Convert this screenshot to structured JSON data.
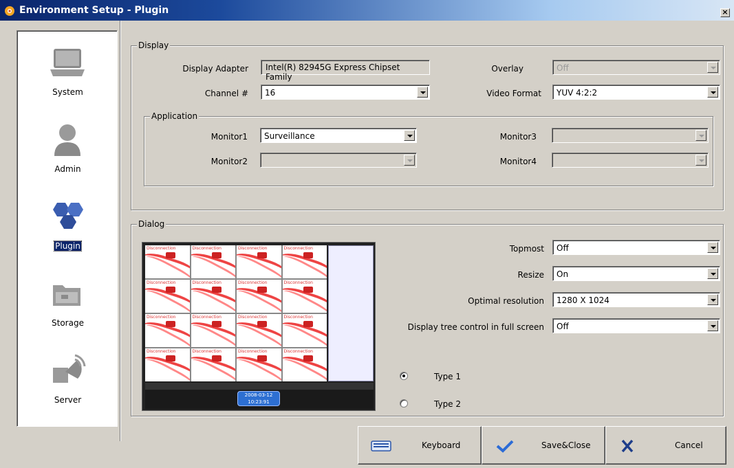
{
  "window": {
    "title": "Environment Setup - Plugin",
    "close_glyph": "×"
  },
  "nav": {
    "items": [
      {
        "label": "System",
        "icon": "laptop-icon"
      },
      {
        "label": "Admin",
        "icon": "user-icon"
      },
      {
        "label": "Plugin",
        "icon": "hexagons-icon",
        "selected": true
      },
      {
        "label": "Storage",
        "icon": "folder-icon"
      },
      {
        "label": "Server",
        "icon": "satellite-icon"
      }
    ]
  },
  "display": {
    "legend": "Display",
    "adapter_label": "Display Adapter",
    "adapter_value": "Intel(R) 82945G Express Chipset Family",
    "overlay_label": "Overlay",
    "overlay_value": "Off",
    "channel_label": "Channel #",
    "channel_value": "16",
    "video_format_label": "Video Format",
    "video_format_value": "YUV 4:2:2",
    "application": {
      "legend": "Application",
      "monitor1_label": "Monitor1",
      "monitor1_value": "Surveillance",
      "monitor2_label": "Monitor2",
      "monitor2_value": "",
      "monitor3_label": "Monitor3",
      "monitor3_value": "",
      "monitor4_label": "Monitor4",
      "monitor4_value": ""
    }
  },
  "dialog": {
    "legend": "Dialog",
    "topmost_label": "Topmost",
    "topmost_value": "Off",
    "resize_label": "Resize",
    "resize_value": "On",
    "resolution_label": "Optimal resolution",
    "resolution_value": "1280 X 1024",
    "tree_label": "Display tree control in full screen",
    "tree_value": "Off",
    "type1_label": "Type 1",
    "type2_label": "Type 2",
    "selected_type": "Type 1",
    "preview": {
      "cell_text": "Disconnection",
      "clock_date": "2008-03-12",
      "clock_time": "10:23:91"
    }
  },
  "buttons": {
    "keyboard": "Keyboard",
    "save_close": "Save&Close",
    "cancel": "Cancel"
  },
  "colors": {
    "titlebar_start": "#0a246a",
    "titlebar_end": "#d8e6f5",
    "face": "#d4d0c8",
    "selection": "#0a246a",
    "check_blue": "#2b6bd6",
    "cancel_x": "#1d3d8a"
  }
}
